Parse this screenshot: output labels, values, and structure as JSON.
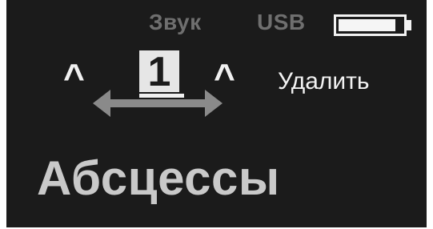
{
  "status_bar": {
    "sound_label": "Звук",
    "usb_label": "USB",
    "battery_level": 0.9
  },
  "selector": {
    "value": "1",
    "left_caret": "^",
    "right_caret": "^"
  },
  "actions": {
    "delete_label": "Удалить"
  },
  "main": {
    "title": "Абсцессы"
  },
  "colors": {
    "screen_background": "#1b1b1b",
    "foreground": "#f2f2f2",
    "muted": "#6f6f6f",
    "title": "#c9c9c9",
    "arrow": "#8a8a8a"
  },
  "icons": {
    "battery": "battery-icon",
    "scroll_arrows": "left-right-arrow-icon"
  }
}
